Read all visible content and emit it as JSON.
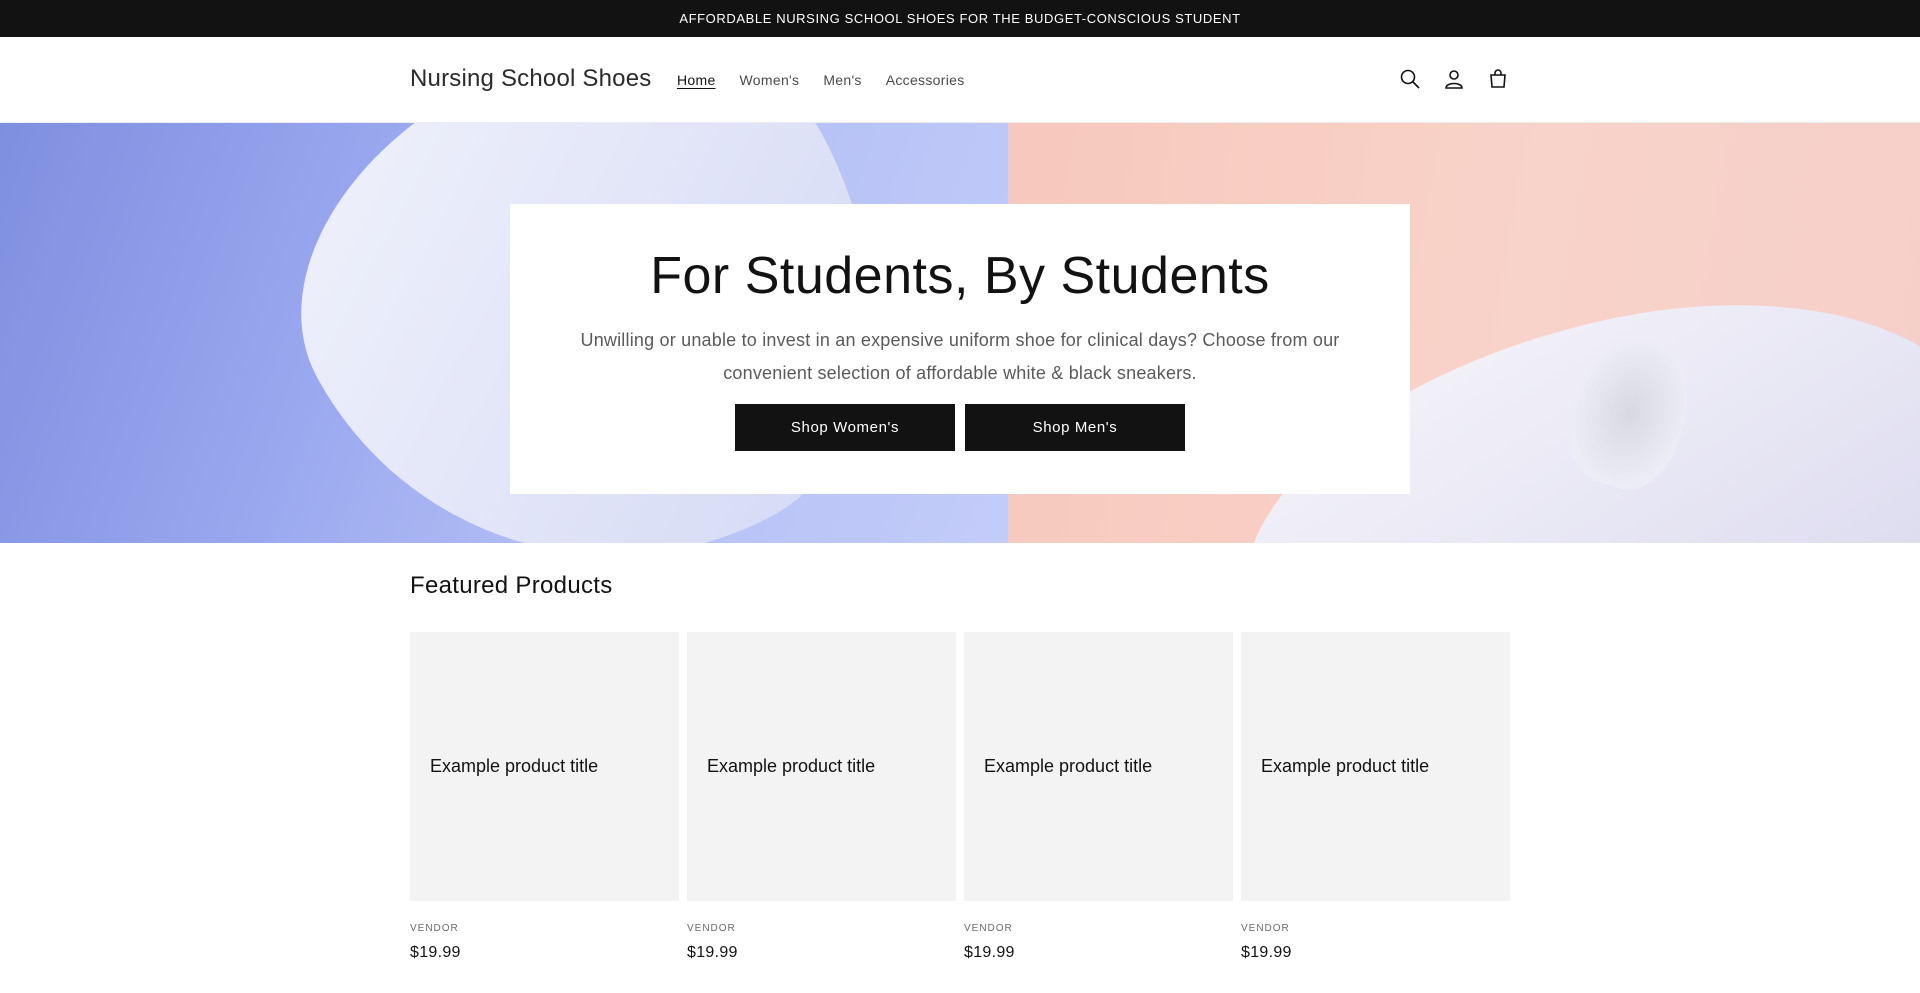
{
  "announcement": {
    "text": "AFFORDABLE NURSING SCHOOL SHOES FOR THE BUDGET-CONSCIOUS STUDENT"
  },
  "header": {
    "logo": "Nursing School Shoes",
    "nav": [
      {
        "label": "Home",
        "active": true
      },
      {
        "label": "Women's",
        "active": false
      },
      {
        "label": "Men's",
        "active": false
      },
      {
        "label": "Accessories",
        "active": false
      }
    ],
    "icons": [
      "search-icon",
      "account-icon",
      "cart-icon"
    ]
  },
  "hero": {
    "title": "For Students, By Students",
    "text": "Unwilling or unable to invest in an expensive uniform shoe for clinical days? Choose from our convenient selection of affordable white & black sneakers.",
    "buttons": [
      "Shop Women's",
      "Shop Men's"
    ]
  },
  "featured": {
    "heading": "Featured Products",
    "products": [
      {
        "title": "Example product title",
        "vendor": "VENDOR",
        "price": "$19.99"
      },
      {
        "title": "Example product title",
        "vendor": "VENDOR",
        "price": "$19.99"
      },
      {
        "title": "Example product title",
        "vendor": "VENDOR",
        "price": "$19.99"
      },
      {
        "title": "Example product title",
        "vendor": "VENDOR",
        "price": "$19.99"
      }
    ]
  },
  "colors": {
    "dark": "#121212",
    "hero_blue": "#9aa8ef",
    "hero_peach": "#f8d3c9",
    "card_bg": "#f3f3f3"
  }
}
